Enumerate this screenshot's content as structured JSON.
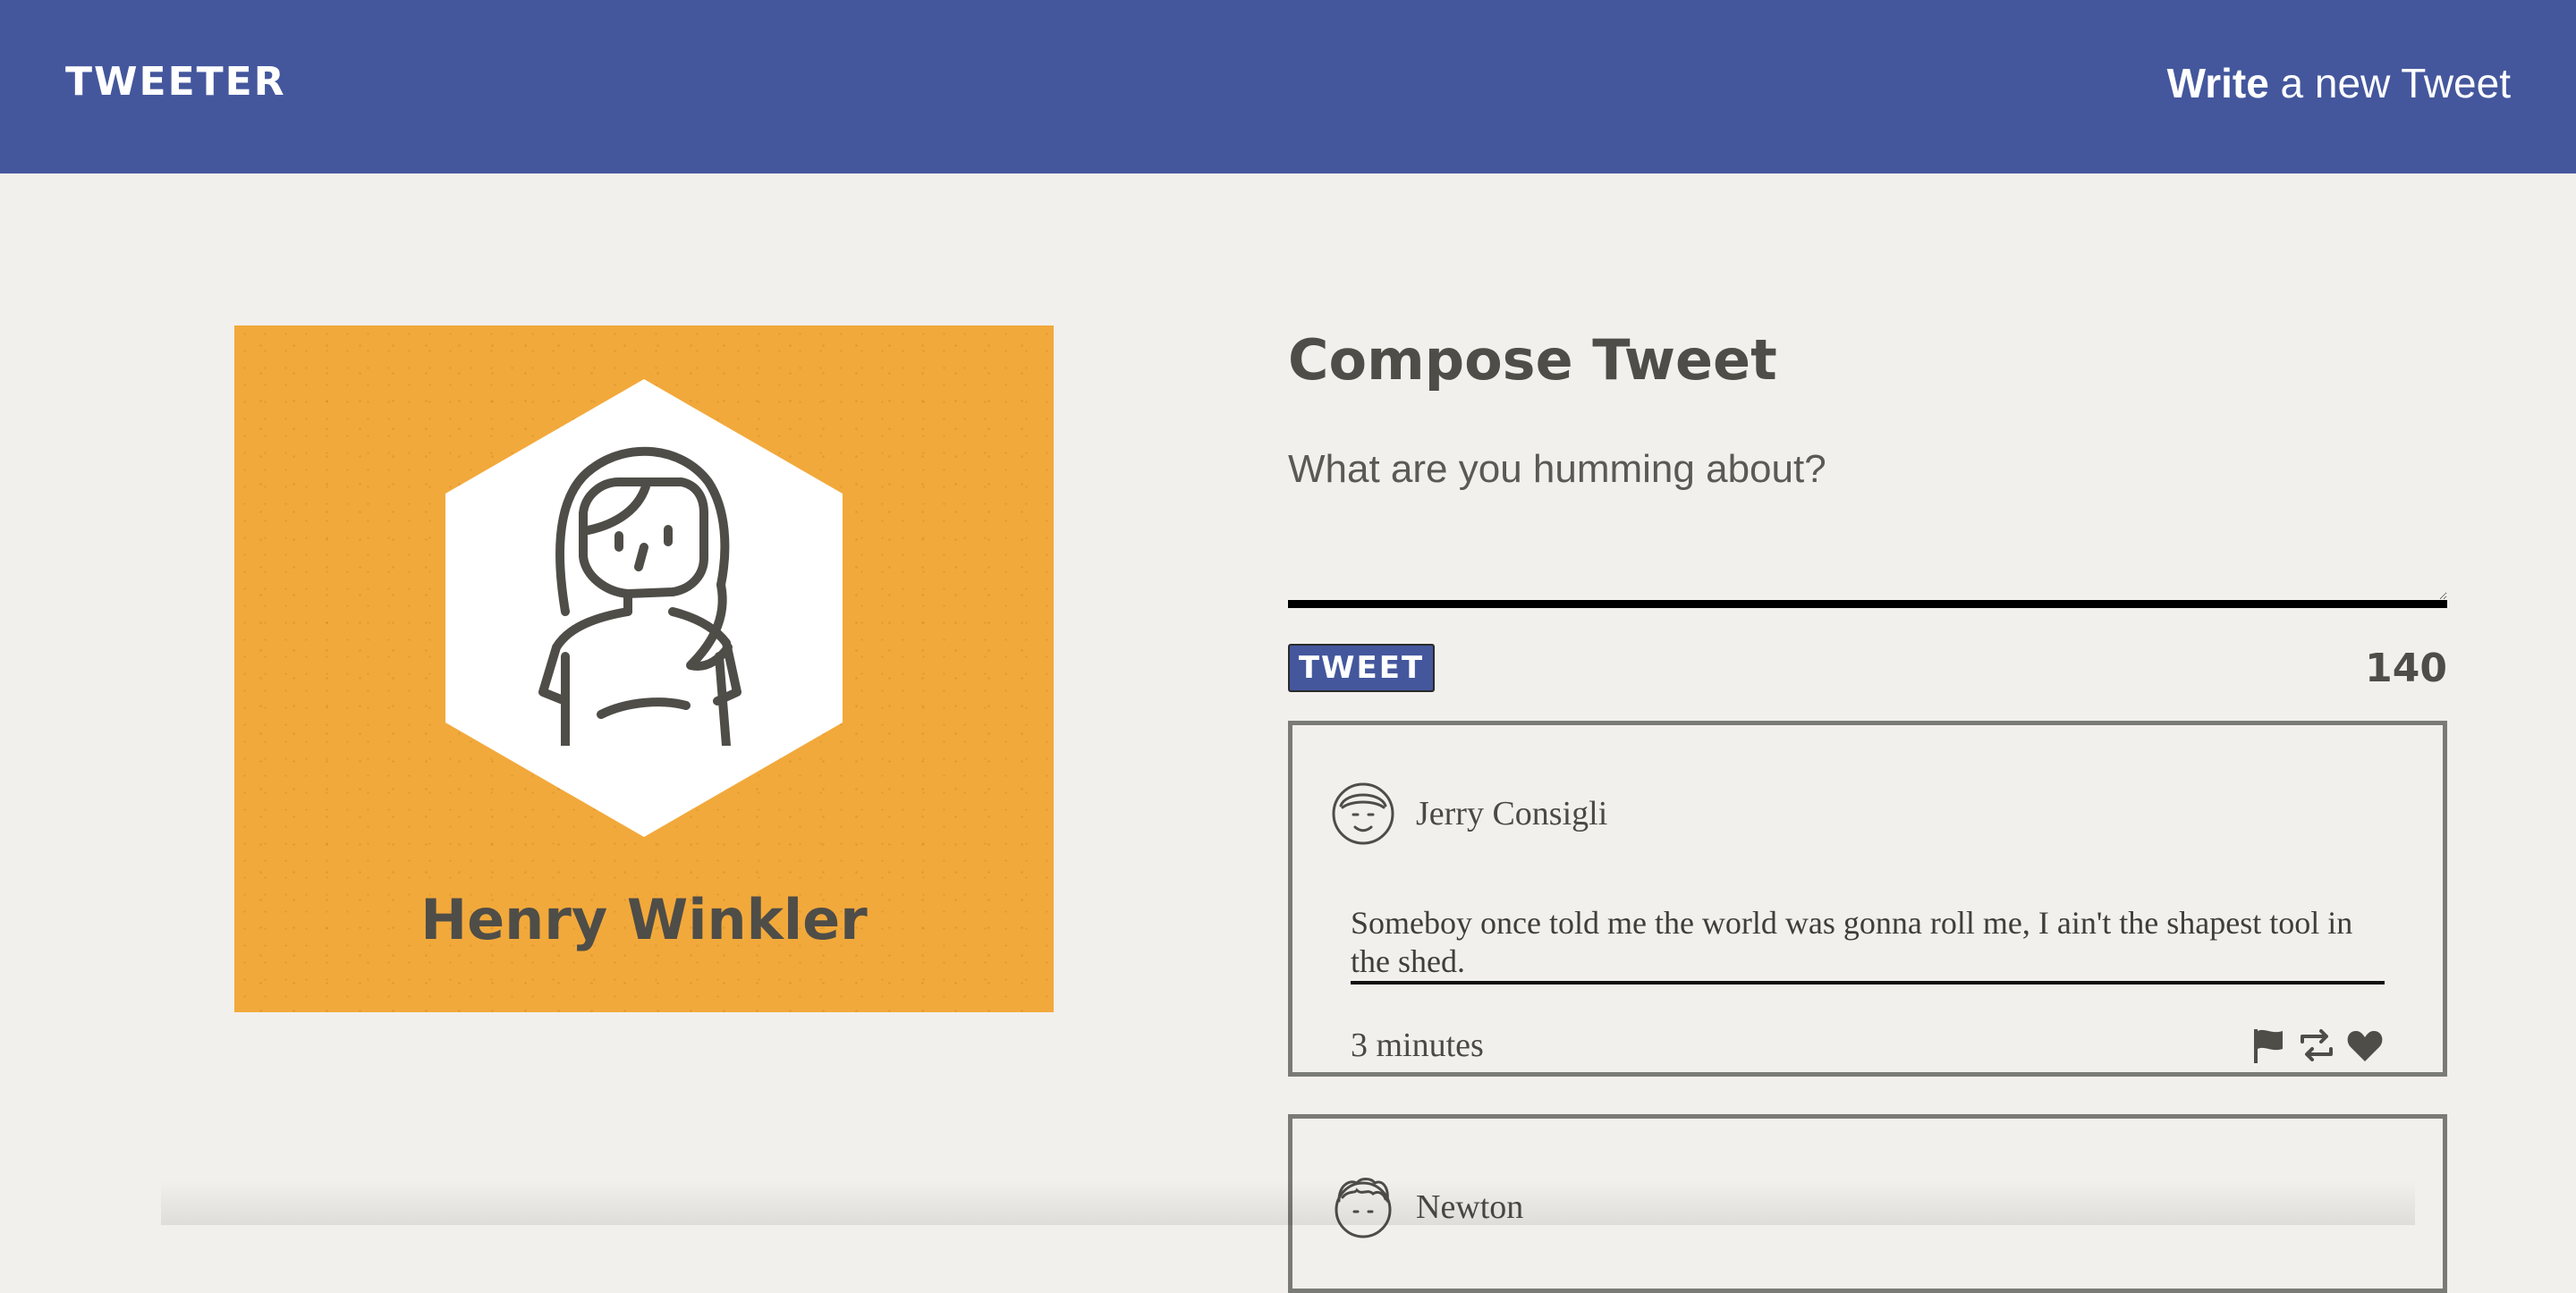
{
  "nav": {
    "brand": "TWEETER",
    "compose_link_bold": "Write",
    "compose_link_rest": " a new Tweet"
  },
  "profile": {
    "name": "Henry Winkler",
    "background_color": "#f2a93b"
  },
  "compose": {
    "title": "Compose Tweet",
    "placeholder": "What are you humming about?",
    "tweet_button_label": "TWEET",
    "char_count": "140"
  },
  "tweets": [
    {
      "author": "Jerry Consigli",
      "text": "Someboy once told me the world was gonna roll me, I ain't the shapest tool in the shed.",
      "time": "3 minutes",
      "actions": [
        "flag-icon",
        "retweet-icon",
        "heart-icon"
      ]
    },
    {
      "author": "Newton"
    }
  ],
  "colors": {
    "accent": "#44579d",
    "background": "#f2f0ec",
    "text": "#4e4d48"
  }
}
